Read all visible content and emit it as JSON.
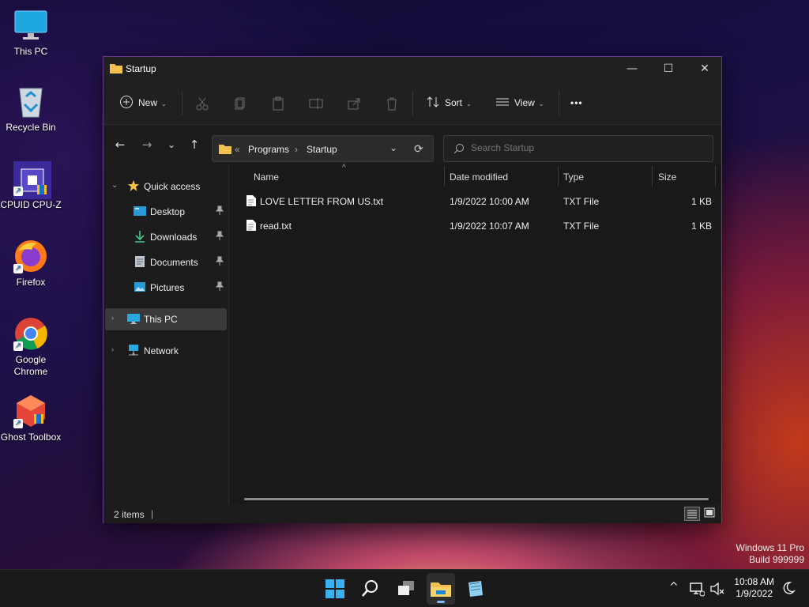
{
  "desktop": {
    "icons": [
      {
        "label": "This PC"
      },
      {
        "label": "Recycle Bin"
      },
      {
        "label": "CPUID CPU-Z"
      },
      {
        "label": "Firefox"
      },
      {
        "label": "Google Chrome"
      },
      {
        "label": "Ghost Toolbox"
      }
    ],
    "shortcut_glyph": "↗"
  },
  "window": {
    "title": "Startup",
    "controls": {
      "minimize": "—",
      "maximize": "☐",
      "close": "✕"
    },
    "toolbar": {
      "new_label": "New",
      "sort_label": "Sort",
      "view_label": "View",
      "more_label": "•••",
      "chevron": "⌄"
    },
    "nav": {
      "back": "←",
      "forward": "→",
      "recent": "⌄",
      "up": "↑",
      "address": {
        "overflow": "«",
        "segments": [
          "Programs",
          "Startup"
        ],
        "separator": "›"
      },
      "refresh": "⟳",
      "search_placeholder": "Search Startup"
    },
    "navpane": {
      "quick_access": "Quick access",
      "pinned": [
        {
          "label": "Desktop"
        },
        {
          "label": "Downloads"
        },
        {
          "label": "Documents"
        },
        {
          "label": "Pictures"
        }
      ],
      "this_pc": "This PC",
      "network": "Network",
      "pin_glyph": "📌"
    },
    "columns": {
      "name": "Name",
      "date": "Date modified",
      "type": "Type",
      "size": "Size",
      "sort_indicator": "^"
    },
    "files": [
      {
        "name": "LOVE LETTER FROM US.txt",
        "date": "1/9/2022 10:00 AM",
        "type": "TXT File",
        "size": "1 KB"
      },
      {
        "name": "read.txt",
        "date": "1/9/2022 10:07 AM",
        "type": "TXT File",
        "size": "1 KB"
      }
    ],
    "status": {
      "count": "2 items",
      "cursor": "|"
    }
  },
  "watermark": {
    "line1": "Windows 11 Pro",
    "line2": "Build 999999"
  },
  "taskbar": {
    "time": "10:08 AM",
    "date": "1/9/2022",
    "tray_chevron": "^"
  },
  "colors": {
    "accent": "#0078d4",
    "folder": "#f4c04e",
    "window_border": "#6a3a8a"
  }
}
